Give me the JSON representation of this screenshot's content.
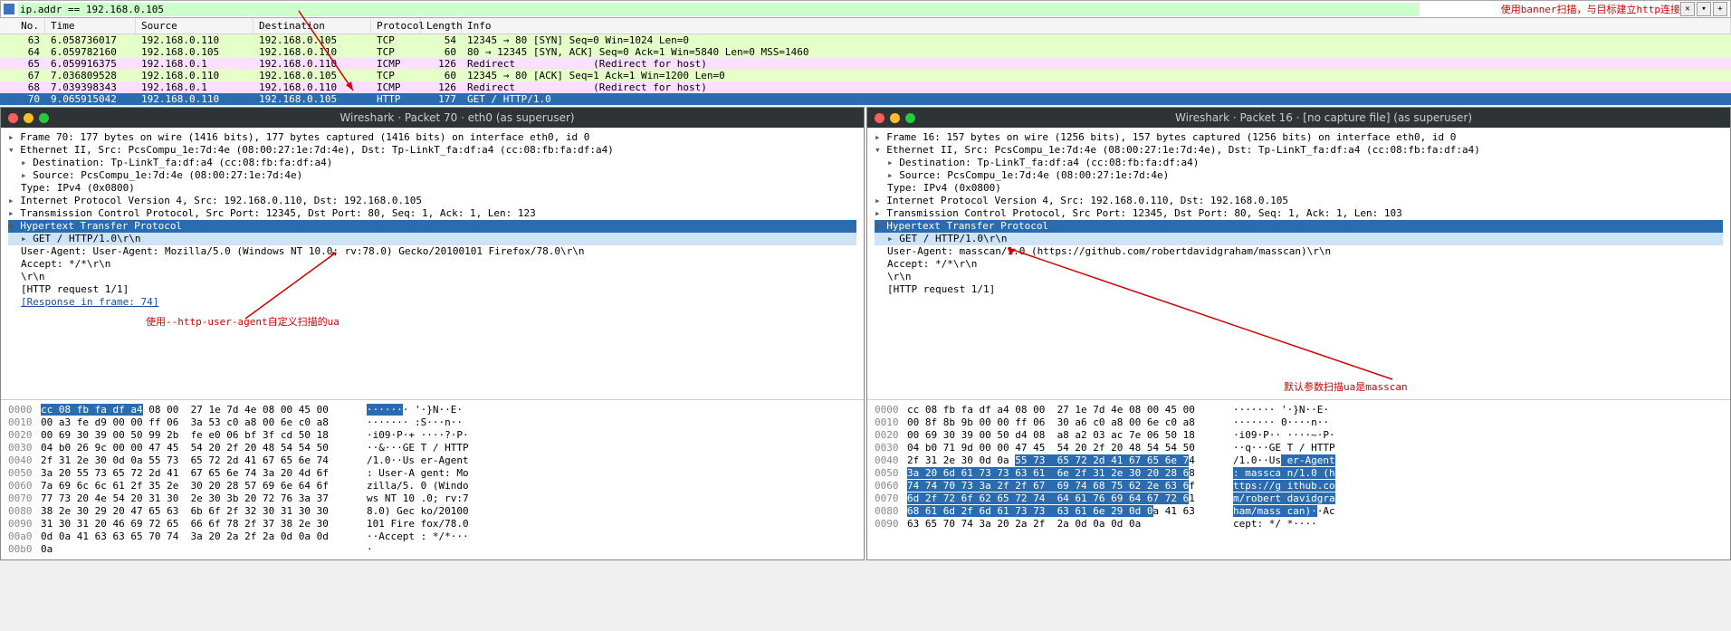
{
  "filter": {
    "value": "ip.addr == 192.168.0.105",
    "annotation": "使用banner扫描，与目标建立http连接",
    "close": "✕",
    "dd": "▾",
    "plus": "+"
  },
  "headers": {
    "no": "No.",
    "time": "Time",
    "src": "Source",
    "dst": "Destination",
    "proto": "Protocol",
    "len": "Length",
    "info": "Info"
  },
  "rows": [
    {
      "no": "63",
      "time": "6.058736017",
      "src": "192.168.0.110",
      "dst": "192.168.0.105",
      "proto": "TCP",
      "len": "54",
      "info": "12345 → 80 [SYN] Seq=0 Win=1024 Len=0",
      "cls": "green"
    },
    {
      "no": "64",
      "time": "6.059782160",
      "src": "192.168.0.105",
      "dst": "192.168.0.110",
      "proto": "TCP",
      "len": "60",
      "info": "80 → 12345 [SYN, ACK] Seq=0 Ack=1 Win=5840 Len=0 MSS=1460",
      "cls": "green"
    },
    {
      "no": "65",
      "time": "6.059916375",
      "src": "192.168.0.1",
      "dst": "192.168.0.110",
      "proto": "ICMP",
      "len": "126",
      "info": "Redirect             (Redirect for host)",
      "cls": "pink"
    },
    {
      "no": "67",
      "time": "7.036809528",
      "src": "192.168.0.110",
      "dst": "192.168.0.105",
      "proto": "TCP",
      "len": "60",
      "info": "12345 → 80 [ACK] Seq=1 Ack=1 Win=1200 Len=0",
      "cls": "green"
    },
    {
      "no": "68",
      "time": "7.039398343",
      "src": "192.168.0.1",
      "dst": "192.168.0.110",
      "proto": "ICMP",
      "len": "126",
      "info": "Redirect             (Redirect for host)",
      "cls": "pink"
    },
    {
      "no": "70",
      "time": "9.065915042",
      "src": "192.168.0.110",
      "dst": "192.168.0.105",
      "proto": "HTTP",
      "len": "177",
      "info": "GET / HTTP/1.0",
      "cls": "sel"
    }
  ],
  "left": {
    "title": "Wireshark · Packet 70 · eth0 (as superuser)",
    "lines": [
      {
        "t": "Frame 70: 177 bytes on wire (1416 bits), 177 bytes captured (1416 bits) on interface eth0, id 0",
        "cls": "expand"
      },
      {
        "t": "Ethernet II, Src: PcsCompu_1e:7d:4e (08:00:27:1e:7d:4e), Dst: Tp-LinkT_fa:df:a4 (cc:08:fb:fa:df:a4)",
        "cls": "collapsed"
      },
      {
        "t": "Destination: Tp-LinkT_fa:df:a4 (cc:08:fb:fa:df:a4)",
        "cls": "expand i1"
      },
      {
        "t": "Source: PcsCompu_1e:7d:4e (08:00:27:1e:7d:4e)",
        "cls": "expand i1"
      },
      {
        "t": "Type: IPv4 (0x0800)",
        "cls": "i1"
      },
      {
        "t": "Internet Protocol Version 4, Src: 192.168.0.110, Dst: 192.168.0.105",
        "cls": "expand"
      },
      {
        "t": "Transmission Control Protocol, Src Port: 12345, Dst Port: 80, Seq: 1, Ack: 1, Len: 123",
        "cls": "expand"
      },
      {
        "t": "Hypertext Transfer Protocol",
        "cls": "collapsed highlight"
      },
      {
        "t": "GET / HTTP/1.0\\r\\n",
        "cls": "expand i1 subhl"
      },
      {
        "t": "User-Agent: User-Agent: Mozilla/5.0 (Windows NT 10.0; rv:78.0) Gecko/20100101 Firefox/78.0\\r\\n",
        "cls": "i1"
      },
      {
        "t": "Accept: */*\\r\\n",
        "cls": "i1"
      },
      {
        "t": "\\r\\n",
        "cls": "i1"
      },
      {
        "t": "[HTTP request 1/1]",
        "cls": "i1"
      },
      {
        "t": "[Response in frame: 74]",
        "cls": "i1",
        "link": true
      }
    ],
    "annotation": "使用--http-user-agent自定义扫描的ua",
    "hex": [
      {
        "o": "0000",
        "b": "cc 08 fb fa df a4 08 00  27 1e 7d 4e 08 00 45 00",
        "a": "······· '·}N··E·",
        "hl": [
          0,
          17
        ]
      },
      {
        "o": "0010",
        "b": "00 a3 fe d9 00 00 ff 06  3a 53 c0 a8 00 6e c0 a8",
        "a": "······· :S···n··"
      },
      {
        "o": "0020",
        "b": "00 69 30 39 00 50 99 2b  fe e0 06 bf 3f cd 50 18",
        "a": "·i09·P·+ ····?·P·"
      },
      {
        "o": "0030",
        "b": "04 b0 26 9c 00 00 47 45  54 20 2f 20 48 54 54 50",
        "a": "··&···GE T / HTTP"
      },
      {
        "o": "0040",
        "b": "2f 31 2e 30 0d 0a 55 73  65 72 2d 41 67 65 6e 74",
        "a": "/1.0··Us er-Agent"
      },
      {
        "o": "0050",
        "b": "3a 20 55 73 65 72 2d 41  67 65 6e 74 3a 20 4d 6f",
        "a": ": User-A gent: Mo"
      },
      {
        "o": "0060",
        "b": "7a 69 6c 6c 61 2f 35 2e  30 20 28 57 69 6e 64 6f",
        "a": "zilla/5. 0 (Windo"
      },
      {
        "o": "0070",
        "b": "77 73 20 4e 54 20 31 30  2e 30 3b 20 72 76 3a 37",
        "a": "ws NT 10 .0; rv:7"
      },
      {
        "o": "0080",
        "b": "38 2e 30 29 20 47 65 63  6b 6f 2f 32 30 31 30 30",
        "a": "8.0) Gec ko/20100"
      },
      {
        "o": "0090",
        "b": "31 30 31 20 46 69 72 65  66 6f 78 2f 37 38 2e 30",
        "a": "101 Fire fox/78.0"
      },
      {
        "o": "00a0",
        "b": "0d 0a 41 63 63 65 70 74  3a 20 2a 2f 2a 0d 0a 0d",
        "a": "··Accept : */*···"
      },
      {
        "o": "00b0",
        "b": "0a",
        "a": "·"
      }
    ]
  },
  "right": {
    "title": "Wireshark · Packet 16 · [no capture file] (as superuser)",
    "lines": [
      {
        "t": "Frame 16: 157 bytes on wire (1256 bits), 157 bytes captured (1256 bits) on interface eth0, id 0",
        "cls": "expand"
      },
      {
        "t": "Ethernet II, Src: PcsCompu_1e:7d:4e (08:00:27:1e:7d:4e), Dst: Tp-LinkT_fa:df:a4 (cc:08:fb:fa:df:a4)",
        "cls": "collapsed"
      },
      {
        "t": "Destination: Tp-LinkT_fa:df:a4 (cc:08:fb:fa:df:a4)",
        "cls": "expand i1"
      },
      {
        "t": "Source: PcsCompu_1e:7d:4e (08:00:27:1e:7d:4e)",
        "cls": "expand i1"
      },
      {
        "t": "Type: IPv4 (0x0800)",
        "cls": "i1"
      },
      {
        "t": "Internet Protocol Version 4, Src: 192.168.0.110, Dst: 192.168.0.105",
        "cls": "expand"
      },
      {
        "t": "Transmission Control Protocol, Src Port: 12345, Dst Port: 80, Seq: 1, Ack: 1, Len: 103",
        "cls": "expand"
      },
      {
        "t": "Hypertext Transfer Protocol",
        "cls": "collapsed highlight"
      },
      {
        "t": "GET / HTTP/1.0\\r\\n",
        "cls": "expand i1 subhl"
      },
      {
        "t": "User-Agent: masscan/1.0 (https://github.com/robertdavidgraham/masscan)\\r\\n",
        "cls": "i1"
      },
      {
        "t": "Accept: */*\\r\\n",
        "cls": "i1"
      },
      {
        "t": "\\r\\n",
        "cls": "i1"
      },
      {
        "t": "[HTTP request 1/1]",
        "cls": "i1"
      }
    ],
    "annotation": "默认参数扫描ua是masscan",
    "hex": [
      {
        "o": "0000",
        "b": "cc 08 fb fa df a4 08 00  27 1e 7d 4e 08 00 45 00",
        "a": "······· '·}N··E·"
      },
      {
        "o": "0010",
        "b": "00 8f 8b 9b 00 00 ff 06  30 a6 c0 a8 00 6e c0 a8",
        "a": "······· 0····n··"
      },
      {
        "o": "0020",
        "b": "00 69 30 39 00 50 d4 08  a8 a2 03 ac 7e 06 50 18",
        "a": "·i09·P·· ····~·P·"
      },
      {
        "o": "0030",
        "b": "04 b0 71 9d 00 00 47 45  54 20 2f 20 48 54 54 50",
        "a": "··q···GE T / HTTP"
      },
      {
        "o": "0040",
        "b": "2f 31 2e 30 0d 0a 55 73  65 72 2d 41 67 65 6e 74",
        "a": "/1.0··Us er-Agent",
        "hlb": [
          18,
          47
        ],
        "hla": [
          8,
          16
        ]
      },
      {
        "o": "0050",
        "b": "3a 20 6d 61 73 73 63 61  6e 2f 31 2e 30 20 28 68",
        "a": ": massca n/1.0 (h",
        "hlb": [
          0,
          47
        ],
        "hla": [
          0,
          16
        ]
      },
      {
        "o": "0060",
        "b": "74 74 70 73 3a 2f 2f 67  69 74 68 75 62 2e 63 6f",
        "a": "ttps://g ithub.co",
        "hlb": [
          0,
          47
        ],
        "hla": [
          0,
          16
        ]
      },
      {
        "o": "0070",
        "b": "6d 2f 72 6f 62 65 72 74  64 61 76 69 64 67 72 61",
        "a": "m/robert davidgra",
        "hlb": [
          0,
          47
        ],
        "hla": [
          0,
          16
        ]
      },
      {
        "o": "0080",
        "b": "68 61 6d 2f 6d 61 73 73  63 61 6e 29 0d 0a 41 63",
        "a": "ham/mass can)··Ac",
        "hlb": [
          0,
          41
        ],
        "hla": [
          0,
          13
        ]
      },
      {
        "o": "0090",
        "b": "63 65 70 74 3a 20 2a 2f  2a 0d 0a 0d 0a",
        "a": "cept: */ *····"
      }
    ]
  }
}
